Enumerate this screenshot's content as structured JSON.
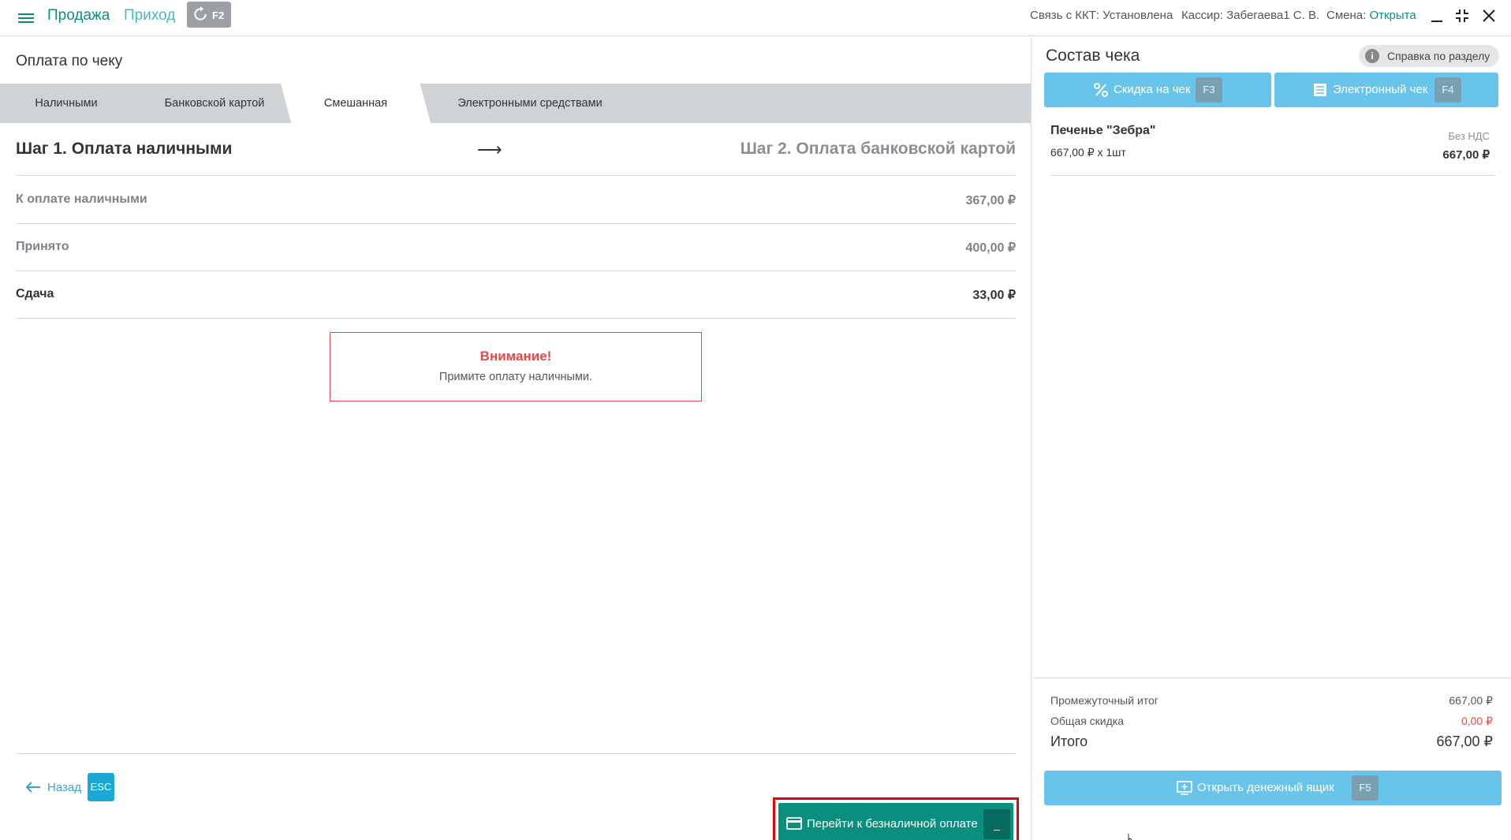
{
  "topbar": {
    "sale": "Продажа",
    "income": "Приход",
    "f2_key": "F2",
    "kkt_label": "Связь с ККТ: ",
    "kkt_value": "Установлена",
    "cashier": "Кассир: Забегаева1 С. В.",
    "shift_label": "Смена: ",
    "shift_value": "Открыта"
  },
  "payment": {
    "title": "Оплата по чеку",
    "tabs": [
      {
        "label": "Наличными",
        "active": false
      },
      {
        "label": "Банковской картой",
        "active": false
      },
      {
        "label": "Смешанная",
        "active": true
      },
      {
        "label": "Электронными средствами",
        "active": false
      }
    ],
    "step1": "Шаг 1. Оплата наличными",
    "arrow": "⟶",
    "step2": "Шаг 2. Оплата банковской картой",
    "rows": [
      {
        "label": "К оплате наличными",
        "value": "367,00 ₽"
      },
      {
        "label": "Принято",
        "value": "400,00 ₽"
      },
      {
        "label": "Сдача",
        "value": "33,00 ₽"
      }
    ],
    "alert": {
      "title": "Внимание!",
      "message": "Примите оплату наличными."
    },
    "back_label": "Назад",
    "back_key": "ESC",
    "next_label": "Перейти к безналичной оплате",
    "next_key": "_"
  },
  "receipt": {
    "title": "Состав чека",
    "help": "Справка по разделу",
    "discount_btn": "Скидка на чек",
    "discount_key": "F3",
    "echeck_btn": "Электронный чек",
    "echeck_key": "F4",
    "items": [
      {
        "name": "Печенье \"Зебра\"",
        "qty": "667,00 ₽ x 1шт",
        "vat": "Без НДС",
        "sum": "667,00 ₽"
      }
    ],
    "subtotal_label": "Промежуточный итог",
    "subtotal_value": "667,00 ₽",
    "discount_label": "Общая скидка",
    "discount_value": "0,00 ₽",
    "total_label": "Итого",
    "total_value": "667,00 ₽",
    "cashbox_btn": "Открыть денежный ящик",
    "cashbox_key": "F5"
  },
  "colors": {
    "brand": "#0a8f7f",
    "accent_blue": "#69c4ec",
    "alert_red": "#e24a4a",
    "highlight": "#e3000f"
  }
}
